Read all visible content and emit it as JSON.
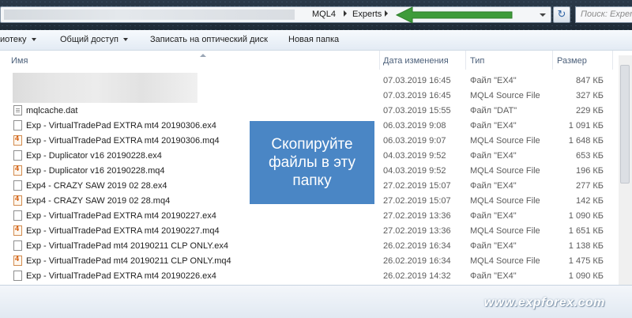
{
  "address_bar": {
    "crumbs": [
      "MQL4",
      "Experts"
    ],
    "search_placeholder": "Поиск: Experts"
  },
  "toolbar": {
    "library_label": "иотеку",
    "share_label": "Общий доступ",
    "burn_label": "Записать на оптический диск",
    "new_folder_label": "Новая папка"
  },
  "columns": {
    "name": "Имя",
    "date": "Дата изменения",
    "type": "Тип",
    "size": "Размер"
  },
  "files": [
    {
      "name": "",
      "date": "07.03.2019 16:45",
      "type": "Файл \"EX4\"",
      "size": "847 КБ",
      "icon": "hidden"
    },
    {
      "name": "",
      "date": "07.03.2019 16:45",
      "type": "MQL4 Source File",
      "size": "327 КБ",
      "icon": "hidden"
    },
    {
      "name": "mqlcache.dat",
      "date": "07.03.2019 15:55",
      "type": "Файл \"DAT\"",
      "size": "229 КБ",
      "icon": "dat"
    },
    {
      "name": "Exp - VirtualTradePad EXTRA mt4 20190306.ex4",
      "date": "06.03.2019 9:08",
      "type": "Файл \"EX4\"",
      "size": "1 091 КБ",
      "icon": "ex4"
    },
    {
      "name": "Exp - VirtualTradePad EXTRA mt4 20190306.mq4",
      "date": "06.03.2019 9:07",
      "type": "MQL4 Source File",
      "size": "1 648 КБ",
      "icon": "mq4"
    },
    {
      "name": "Exp - Duplicator v16 20190228.ex4",
      "date": "04.03.2019 9:52",
      "type": "Файл \"EX4\"",
      "size": "653 КБ",
      "icon": "ex4"
    },
    {
      "name": "Exp - Duplicator v16 20190228.mq4",
      "date": "04.03.2019 9:52",
      "type": "MQL4 Source File",
      "size": "196 КБ",
      "icon": "mq4"
    },
    {
      "name": "Exp4 - CRAZY SAW 2019 02 28.ex4",
      "date": "27.02.2019 15:07",
      "type": "Файл \"EX4\"",
      "size": "277 КБ",
      "icon": "ex4"
    },
    {
      "name": "Exp4 - CRAZY SAW 2019 02 28.mq4",
      "date": "27.02.2019 15:07",
      "type": "MQL4 Source File",
      "size": "142 КБ",
      "icon": "mq4"
    },
    {
      "name": "Exp - VirtualTradePad EXTRA mt4 20190227.ex4",
      "date": "27.02.2019 13:36",
      "type": "Файл \"EX4\"",
      "size": "1 090 КБ",
      "icon": "ex4"
    },
    {
      "name": "Exp - VirtualTradePad EXTRA mt4 20190227.mq4",
      "date": "27.02.2019 13:36",
      "type": "MQL4 Source File",
      "size": "1 651 КБ",
      "icon": "mq4"
    },
    {
      "name": "Exp - VirtualTradePad mt4 20190211 CLP ONLY.ex4",
      "date": "26.02.2019 16:34",
      "type": "Файл \"EX4\"",
      "size": "1 138 КБ",
      "icon": "ex4"
    },
    {
      "name": "Exp - VirtualTradePad mt4 20190211 CLP ONLY.mq4",
      "date": "26.02.2019 16:34",
      "type": "MQL4 Source File",
      "size": "1 475 КБ",
      "icon": "mq4"
    },
    {
      "name": "Exp - VirtualTradePad EXTRA mt4 20190226.ex4",
      "date": "26.02.2019 14:32",
      "type": "Файл \"EX4\"",
      "size": "1 090 КБ",
      "icon": "ex4"
    }
  ],
  "callout": {
    "lines": [
      "Скопируйте",
      "файлы в эту",
      "папку"
    ],
    "color": "#4a86c5"
  },
  "watermark": "www.expforex.com",
  "accent_colors": {
    "arrow": "#3e9b3a",
    "header_text": "#4c607a"
  }
}
